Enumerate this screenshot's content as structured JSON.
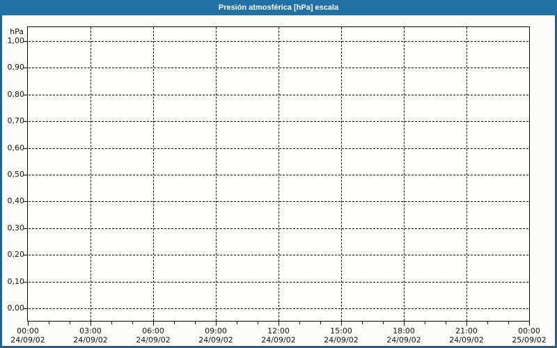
{
  "title_bar": {
    "text": "Presión atmosférica [hPa] escala"
  },
  "colors": {
    "frame_border": "#24618f",
    "titlebar_bg": "#2171a5",
    "titlebar_fg": "#ffffff",
    "page_bg": "#fcfdfa",
    "plot_bg": "#fffffe",
    "grid": "#000000",
    "axis": "#000000",
    "text": "#111111"
  },
  "y_axis": {
    "unit": "hPa",
    "tick_labels": [
      "1,00",
      "0,90",
      "0,80",
      "0,70",
      "0,60",
      "0,50",
      "0,40",
      "0,30",
      "0,20",
      "0,10",
      "0,00"
    ]
  },
  "x_axis": {
    "major_ticks": [
      {
        "time": "00:00",
        "date": "24/09/02"
      },
      {
        "time": "03:00",
        "date": "24/09/02"
      },
      {
        "time": "06:00",
        "date": "24/09/02"
      },
      {
        "time": "09:00",
        "date": "24/09/02"
      },
      {
        "time": "12:00",
        "date": "24/09/02"
      },
      {
        "time": "15:00",
        "date": "24/09/02"
      },
      {
        "time": "18:00",
        "date": "24/09/02"
      },
      {
        "time": "21:00",
        "date": "24/09/02"
      },
      {
        "time": "00:00",
        "date": "25/09/02"
      }
    ]
  },
  "chart_data": {
    "type": "line",
    "title": "Presión atmosférica [hPa] escala",
    "ylabel": "hPa",
    "ylim": [
      0.0,
      1.0
    ],
    "y_tick_interval": 0.1,
    "y_tick_labels": [
      "1,00",
      "0,90",
      "0,80",
      "0,70",
      "0,60",
      "0,50",
      "0,40",
      "0,30",
      "0,20",
      "0,10",
      "0,00"
    ],
    "x_tick_labels": [
      "00:00 24/09/02",
      "03:00 24/09/02",
      "06:00 24/09/02",
      "09:00 24/09/02",
      "12:00 24/09/02",
      "15:00 24/09/02",
      "18:00 24/09/02",
      "21:00 24/09/02",
      "00:00 25/09/02"
    ],
    "x_major_interval_hours": 3,
    "x_minor_interval_hours": 1,
    "grid": "dashed",
    "legend": false,
    "series": []
  }
}
